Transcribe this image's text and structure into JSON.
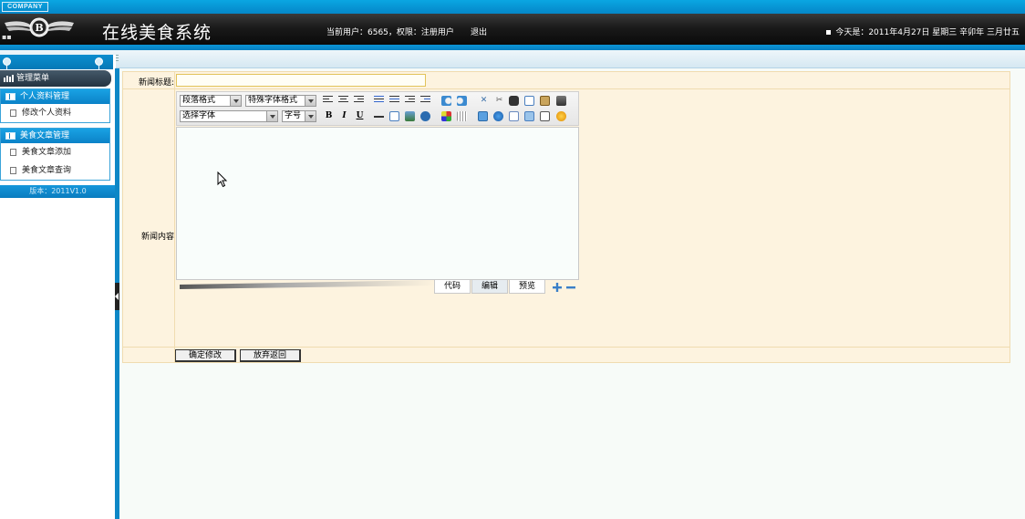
{
  "header": {
    "company": "COMPANY",
    "app_title": "在线美食系统",
    "user_info": "当前用户：6565，权限：注册用户",
    "logout": "退出",
    "date_info": "今天是：2011年4月27日 星期三 辛卯年 三月廿五"
  },
  "sidebar": {
    "menu_title": "管理菜单",
    "groups": [
      {
        "label": "个人资料管理",
        "items": [
          "修改个人资料"
        ]
      },
      {
        "label": "美食文章管理",
        "items": [
          "美食文章添加",
          "美食文章查询"
        ]
      }
    ],
    "version": "版本：2011V1.0"
  },
  "form": {
    "title_label": "新闻标题:",
    "title_value": "",
    "content_label": "新闻内容",
    "toolbar": {
      "paragraph_format": "段落格式",
      "special_format": "特殊字体格式",
      "font_select": "选择字体",
      "font_size": "字号",
      "bold": "B",
      "italic": "I",
      "underline": "U"
    },
    "editor_tabs": [
      "代码",
      "编辑",
      "预览"
    ],
    "active_tab": "编辑",
    "buttons": {
      "confirm": "确定修改",
      "cancel": "放弃返回"
    }
  },
  "colors": {
    "accent": "#0b88c9",
    "header_dark": "#1a1a1a",
    "form_bg": "#fdf3df",
    "form_border": "#f0dcb0"
  }
}
